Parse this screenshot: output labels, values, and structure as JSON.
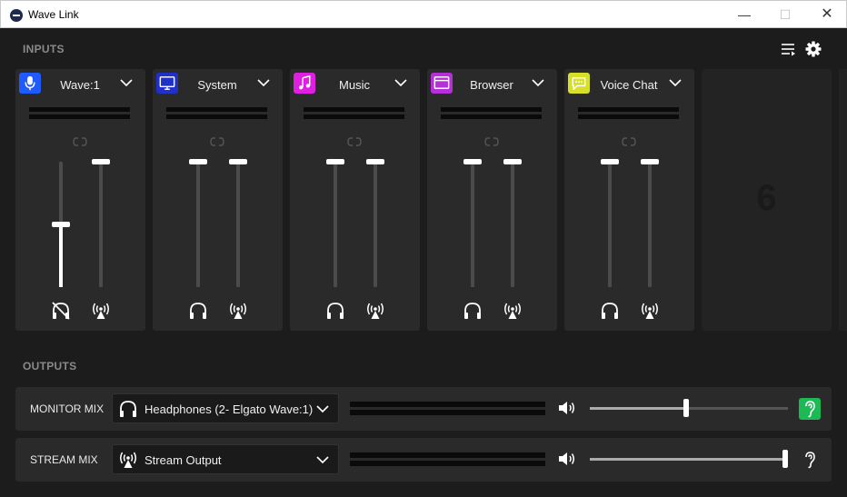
{
  "window": {
    "title": "Wave Link",
    "minimize": "—",
    "maximize": "☐",
    "close": "✕"
  },
  "inputs": {
    "label": "INPUTS",
    "channels": [
      {
        "name": "Wave:1",
        "icon": "microphone-icon",
        "icon_color": "#1f5bff",
        "monitor_level": 0.5,
        "stream_level": 1.0,
        "monitor_muted": true
      },
      {
        "name": "System",
        "icon": "monitor-icon",
        "icon_color": "#2030c8",
        "monitor_level": 1.0,
        "stream_level": 1.0,
        "monitor_muted": false
      },
      {
        "name": "Music",
        "icon": "music-note-icon",
        "icon_color": "#e020e0",
        "monitor_level": 1.0,
        "stream_level": 1.0,
        "monitor_muted": false
      },
      {
        "name": "Browser",
        "icon": "browser-icon",
        "icon_color": "#b630d8",
        "monitor_level": 1.0,
        "stream_level": 1.0,
        "monitor_muted": false
      },
      {
        "name": "Voice Chat",
        "icon": "chat-bubble-icon",
        "icon_color": "#d6e028",
        "monitor_level": 1.0,
        "stream_level": 1.0,
        "monitor_muted": false
      }
    ],
    "empty_slot_number": "6"
  },
  "outputs": {
    "label": "OUTPUTS",
    "mixes": [
      {
        "name": "MONITOR MIX",
        "device": "Headphones (2- Elgato Wave:1)",
        "device_icon": "headphones-icon",
        "volume": 0.5,
        "listen_active": true,
        "listen_color": "#1db954"
      },
      {
        "name": "STREAM MIX",
        "device": "Stream Output",
        "device_icon": "broadcast-icon",
        "volume": 1.0,
        "listen_active": false,
        "listen_color": "#2a2a2a"
      }
    ]
  }
}
